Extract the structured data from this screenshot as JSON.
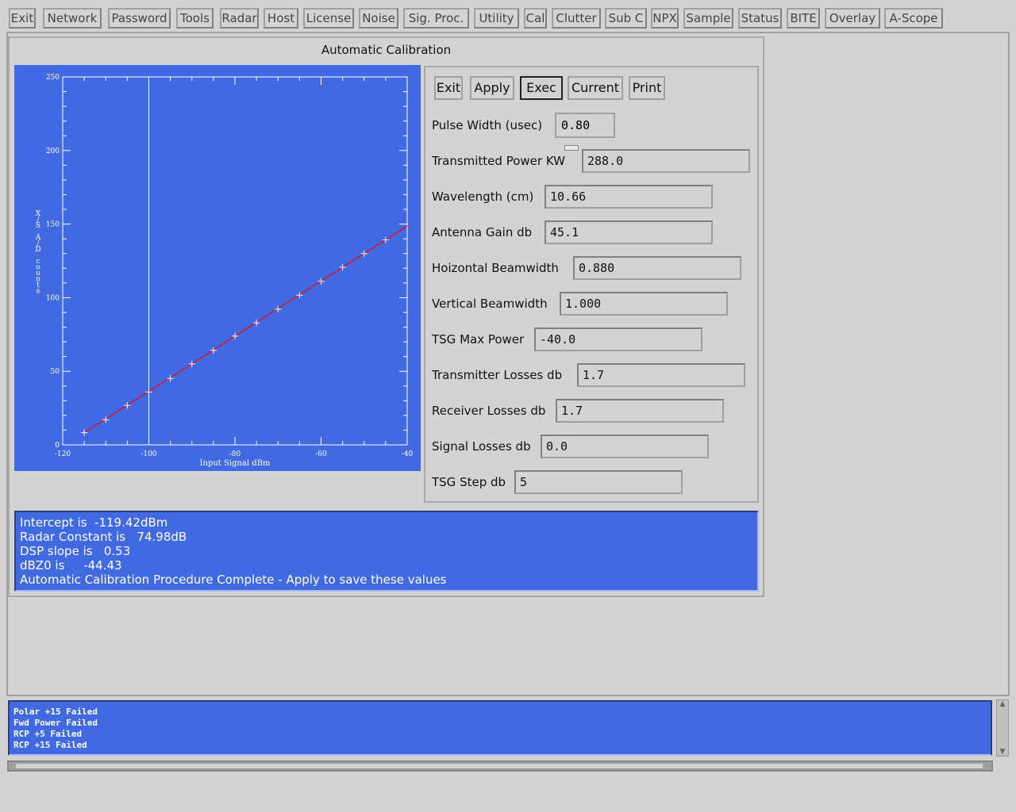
{
  "menu": [
    "Exit",
    "Network",
    "Password",
    "Tools",
    "Radar",
    "Host",
    "License",
    "Noise",
    "Sig. Proc.",
    "Utility",
    "Cal",
    "Clutter",
    "Sub C",
    "NPX",
    "Sample",
    "Status",
    "BITE",
    "Overlay",
    "A-Scope"
  ],
  "panel": {
    "title": "Automatic Calibration",
    "buttons": [
      "Exit",
      "Apply",
      "Exec",
      "Current",
      "Print"
    ],
    "pulse_width": {
      "label": "Pulse Width (usec)",
      "value": "0.80"
    },
    "fields": [
      {
        "label": "Transmitted Power KW",
        "value": "288.0"
      },
      {
        "label": "Wavelength (cm)",
        "value": "10.66"
      },
      {
        "label": "Antenna Gain db",
        "value": "45.1"
      },
      {
        "label": "Hoizontal Beamwidth",
        "value": "0.880"
      },
      {
        "label": "Vertical Beamwidth",
        "value": "1.000"
      },
      {
        "label": "TSG Max Power",
        "value": "-40.0"
      },
      {
        "label": "Transmitter Losses db",
        "value": "1.7"
      },
      {
        "label": "Receiver Losses db",
        "value": "1.7"
      },
      {
        "label": "Signal Losses db",
        "value": "0.0"
      },
      {
        "label": "TSG Step db",
        "value": "5"
      }
    ],
    "messages": [
      "Intercept is  -119.42dBm",
      "Radar Constant is   74.98dB",
      "DSP slope is   0.53",
      "dBZ0 is     -44.43",
      "Automatic Calibration Procedure Complete - Apply to save these values"
    ]
  },
  "log": [
    "Polar +15 Failed",
    "Fwd Power Failed",
    "RCP +5 Failed",
    "RCP +15 Failed"
  ],
  "colors": {
    "plot_bg": "#4169e1",
    "fit_line": "#ff0000",
    "markers": "#ffffff"
  },
  "chart_data": {
    "type": "scatter",
    "xlabel": "Input Signal dBm",
    "ylabel": "X/S A/D counts",
    "xlim": [
      -120,
      -40
    ],
    "ylim": [
      0,
      250
    ],
    "xticks": [
      "-120",
      "-100",
      "-80",
      "-60",
      "-40"
    ],
    "yticks": [
      "0",
      "50",
      "100",
      "150",
      "200",
      "250"
    ],
    "grid": false,
    "reference_line_x": -100,
    "points": {
      "x": [
        -115,
        -110,
        -105,
        -100,
        -95,
        -90,
        -85,
        -80,
        -75,
        -70,
        -65,
        -60,
        -55,
        -50,
        -45
      ],
      "y": [
        8.3,
        17.1,
        26.8,
        35.9,
        45.1,
        55.0,
        64.2,
        73.9,
        82.9,
        92.2,
        101.7,
        111.1,
        120.6,
        129.9,
        139.3
      ]
    },
    "fit_line": {
      "x": [
        -115,
        -40
      ],
      "y": [
        8.3,
        148.8
      ]
    }
  }
}
